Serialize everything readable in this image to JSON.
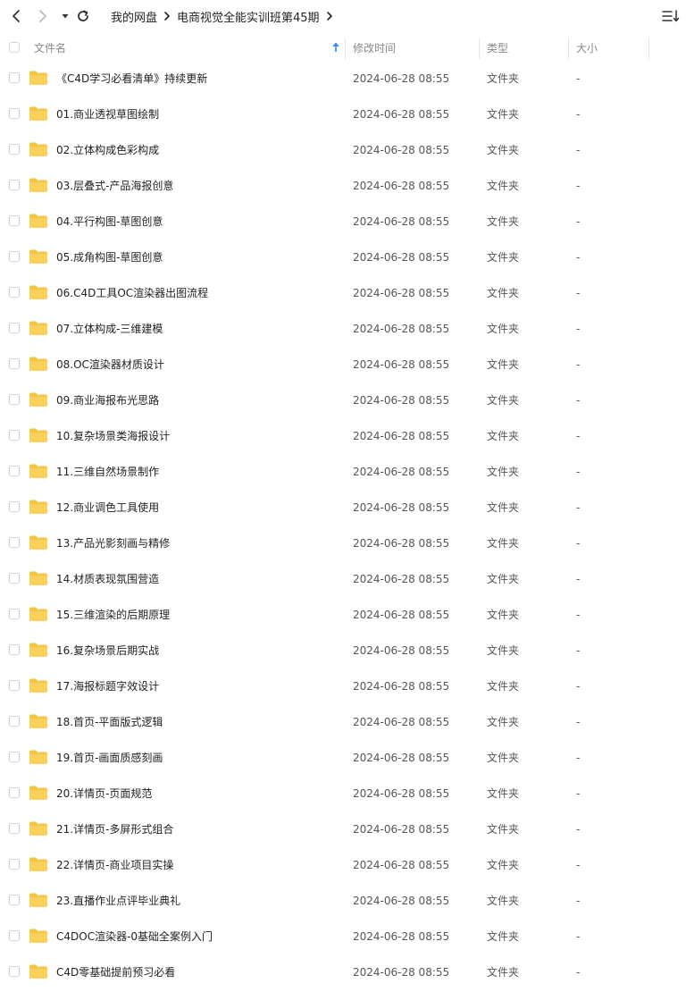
{
  "toolbar": {
    "breadcrumb": [
      "我的网盘",
      "电商视觉全能实训班第45期"
    ]
  },
  "colors": {
    "folder": "#F7C443",
    "accent": "#3C8CE7"
  },
  "columns": {
    "name": "文件名",
    "modified": "修改时间",
    "type": "类型",
    "size": "大小"
  },
  "files": [
    {
      "name": "《C4D学习必看清单》持续更新",
      "modified": "2024-06-28 08:55",
      "type": "文件夹",
      "size": "-"
    },
    {
      "name": "01.商业透视草图绘制",
      "modified": "2024-06-28 08:55",
      "type": "文件夹",
      "size": "-"
    },
    {
      "name": "02.立体构成色彩构成",
      "modified": "2024-06-28 08:55",
      "type": "文件夹",
      "size": "-"
    },
    {
      "name": "03.层叠式-产品海报创意",
      "modified": "2024-06-28 08:55",
      "type": "文件夹",
      "size": "-"
    },
    {
      "name": "04.平行构图-草图创意",
      "modified": "2024-06-28 08:55",
      "type": "文件夹",
      "size": "-"
    },
    {
      "name": "05.成角构图-草图创意",
      "modified": "2024-06-28 08:55",
      "type": "文件夹",
      "size": "-"
    },
    {
      "name": "06.C4D工具OC渲染器出图流程",
      "modified": "2024-06-28 08:55",
      "type": "文件夹",
      "size": "-"
    },
    {
      "name": "07.立体构成-三维建模",
      "modified": "2024-06-28 08:55",
      "type": "文件夹",
      "size": "-"
    },
    {
      "name": "08.OC渲染器材质设计",
      "modified": "2024-06-28 08:55",
      "type": "文件夹",
      "size": "-"
    },
    {
      "name": "09.商业海报布光思路",
      "modified": "2024-06-28 08:55",
      "type": "文件夹",
      "size": "-"
    },
    {
      "name": "10.复杂场景类海报设计",
      "modified": "2024-06-28 08:55",
      "type": "文件夹",
      "size": "-"
    },
    {
      "name": "11.三维自然场景制作",
      "modified": "2024-06-28 08:55",
      "type": "文件夹",
      "size": "-"
    },
    {
      "name": "12.商业调色工具使用",
      "modified": "2024-06-28 08:55",
      "type": "文件夹",
      "size": "-"
    },
    {
      "name": "13.产品光影刻画与精修",
      "modified": "2024-06-28 08:55",
      "type": "文件夹",
      "size": "-"
    },
    {
      "name": "14.材质表现氛围营造",
      "modified": "2024-06-28 08:55",
      "type": "文件夹",
      "size": "-"
    },
    {
      "name": "15.三维渲染的后期原理",
      "modified": "2024-06-28 08:55",
      "type": "文件夹",
      "size": "-"
    },
    {
      "name": "16.复杂场景后期实战",
      "modified": "2024-06-28 08:55",
      "type": "文件夹",
      "size": "-"
    },
    {
      "name": "17.海报标题字效设计",
      "modified": "2024-06-28 08:55",
      "type": "文件夹",
      "size": "-"
    },
    {
      "name": "18.首页-平面版式逻辑",
      "modified": "2024-06-28 08:55",
      "type": "文件夹",
      "size": "-"
    },
    {
      "name": "19.首页-画面质感刻画",
      "modified": "2024-06-28 08:55",
      "type": "文件夹",
      "size": "-"
    },
    {
      "name": "20.详情页-页面规范",
      "modified": "2024-06-28 08:55",
      "type": "文件夹",
      "size": "-"
    },
    {
      "name": "21.详情页-多屏形式组合",
      "modified": "2024-06-28 08:55",
      "type": "文件夹",
      "size": "-"
    },
    {
      "name": "22.详情页-商业项目实操",
      "modified": "2024-06-28 08:55",
      "type": "文件夹",
      "size": "-"
    },
    {
      "name": "23.直播作业点评毕业典礼",
      "modified": "2024-06-28 08:55",
      "type": "文件夹",
      "size": "-"
    },
    {
      "name": "C4DOC渲染器-0基础全案例入门",
      "modified": "2024-06-28 08:55",
      "type": "文件夹",
      "size": "-"
    },
    {
      "name": "C4D零基础提前预习必看",
      "modified": "2024-06-28 08:55",
      "type": "文件夹",
      "size": "-"
    }
  ]
}
